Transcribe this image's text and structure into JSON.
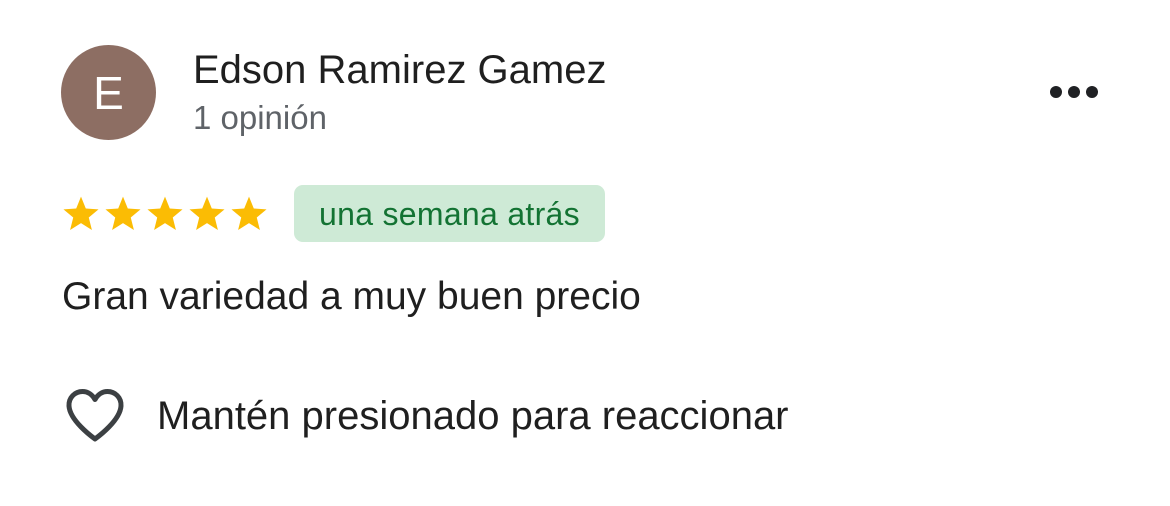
{
  "review": {
    "avatar": {
      "initial": "E",
      "background_color": "#8d6e63"
    },
    "reviewer_name": "Edson Ramirez Gamez",
    "reviewer_meta": "1 opinión",
    "more_menu_icon": "more-horizontal-icon",
    "rating": {
      "stars": 5,
      "max": 5,
      "star_color": "#fbbc04",
      "star_icon": "star-icon"
    },
    "time_badge": {
      "label": "una semana atrás",
      "background_color": "#ceead6",
      "text_color": "#137333"
    },
    "text": "Gran variedad a muy buen precio",
    "reaction": {
      "icon": "heart-outline-icon",
      "label": "Mantén presionado para reaccionar"
    }
  }
}
